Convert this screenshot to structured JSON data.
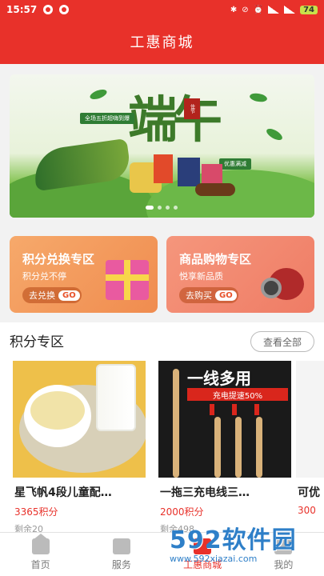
{
  "statusbar": {
    "time": "15:57",
    "battery": "74"
  },
  "header": {
    "title": "工惠商城"
  },
  "banner": {
    "headline": "端午",
    "seal_text": "佳节",
    "tag_left": "全场五折超嗨到爆",
    "tag_right": "优惠满减"
  },
  "promos": [
    {
      "title": "积分兑换专区",
      "subtitle": "积分兑不停",
      "action": "去兑换",
      "go": "GO"
    },
    {
      "title": "商品购物专区",
      "subtitle": "悦享新品质",
      "action": "去购买",
      "go": "GO"
    }
  ],
  "section": {
    "title": "积分专区",
    "view_all": "查看全部"
  },
  "products": [
    {
      "name": "星飞帆4段儿童配…",
      "price": "3365积分",
      "stock": "剩余20"
    },
    {
      "name": "一拖三充电线三…",
      "price": "2000积分",
      "stock": "剩余498",
      "banner_text": "一线多用",
      "red_text": "充电提速50%"
    },
    {
      "name": "可优",
      "price": "300",
      "stock": ""
    }
  ],
  "tabs": [
    {
      "label": "首页",
      "icon": "home-icon"
    },
    {
      "label": "服务",
      "icon": "service-icon"
    },
    {
      "label": "工惠商城",
      "icon": "mall-icon"
    },
    {
      "label": "我的",
      "icon": "profile-icon"
    }
  ],
  "watermark": {
    "brand": "592软件园",
    "url": "www.592xiazai.com"
  }
}
